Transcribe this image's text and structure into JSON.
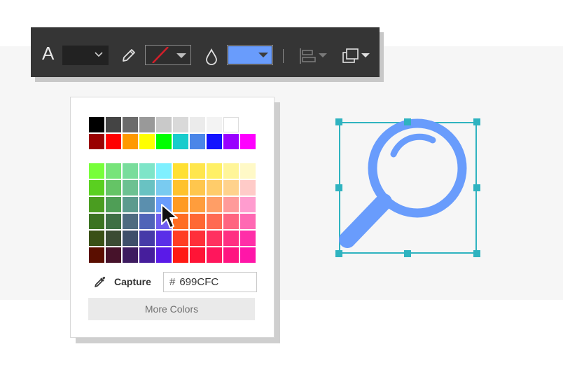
{
  "toolbar": {
    "text_tool_label": "A",
    "stroke_color": "#d21f2a",
    "fill_color": "#699CFC",
    "icons": [
      "text-icon",
      "chevron-down-icon",
      "pen-icon",
      "dropdown-arrow-icon",
      "droplet-icon",
      "align-left-icon",
      "arrange-layers-icon"
    ]
  },
  "picker": {
    "basic_colors": [
      "#000000",
      "#444444",
      "#6b6b6b",
      "#999999",
      "#c9c9c9",
      "#d9d9d9",
      "#ebebeb",
      "#f3f3f3",
      "#ffffff",
      null,
      "#990000",
      "#ff0000",
      "#ff9900",
      "#ffff00",
      "#00ff00",
      "#17cccc",
      "#4a86e8",
      "#1212ff",
      "#9900ff",
      "#ff00ff"
    ],
    "spectrum_colors": [
      "#77ff3a",
      "#77e47a",
      "#79dd9c",
      "#7ee5c8",
      "#7ff0ff",
      "#ffe033",
      "#ffe64d",
      "#fff066",
      "#fff599",
      "#fff9c7",
      "#5ad020",
      "#65c466",
      "#6cc191",
      "#69c2c2",
      "#79cbf0",
      "#ffc22d",
      "#ffc64d",
      "#ffcc6a",
      "#ffd28c",
      "#ffcbc8",
      "#4a9d20",
      "#4f9e56",
      "#5c9b8e",
      "#5b8fae",
      "#699cfc",
      "#ff9a22",
      "#ff9d3c",
      "#ff9e66",
      "#ff9a9a",
      "#ff9ccf",
      "#3b7322",
      "#3e6f44",
      "#4e6b80",
      "#5064b8",
      "#6f5df0",
      "#ff6d22",
      "#ff6833",
      "#ff6a52",
      "#ff6480",
      "#ff68b3",
      "#3a5016",
      "#3b4b34",
      "#3e4f6a",
      "#463aa8",
      "#5a2fe8",
      "#ff3d22",
      "#ff2f3a",
      "#ff3160",
      "#ff2f82",
      "#ff2fa8",
      "#5a0e00",
      "#46122a",
      "#3e1c60",
      "#461e9c",
      "#5a1ae8",
      "#ff1a14",
      "#ff1436",
      "#ff165c",
      "#ff1480",
      "#ff16a8"
    ],
    "capture_label": "Capture",
    "hex_prefix": "#",
    "hex_value": "699CFC",
    "more_colors_label": "More Colors"
  },
  "canvas": {
    "shape_icon": "magnifier-icon",
    "shape_color": "#699cfc",
    "selection_color": "#2fb3c0"
  }
}
